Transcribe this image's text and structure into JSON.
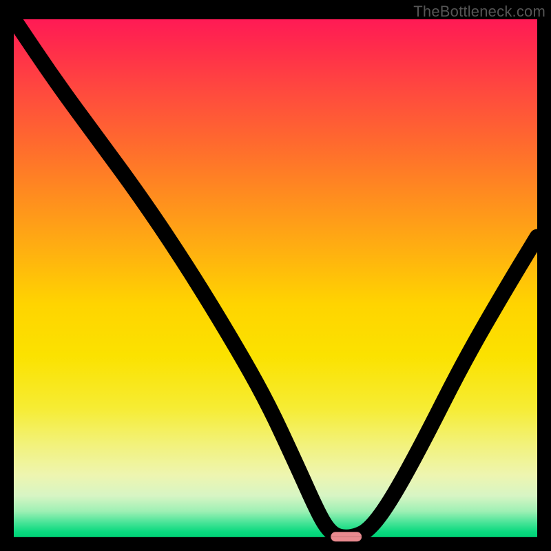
{
  "attribution": "TheBottleneck.com",
  "chart_data": {
    "type": "line",
    "title": "",
    "xlabel": "",
    "ylabel": "",
    "xlim": [
      0,
      100
    ],
    "ylim": [
      0,
      100
    ],
    "series": [
      {
        "name": "bottleneck-curve",
        "x": [
          0,
          8,
          16,
          24,
          32,
          40,
          48,
          54,
          58,
          60,
          62,
          65,
          68,
          72,
          78,
          86,
          94,
          100
        ],
        "values": [
          100,
          88,
          77,
          66,
          54,
          41,
          27,
          14,
          5,
          1.5,
          0,
          0,
          1.5,
          7,
          18,
          34,
          48,
          58
        ]
      }
    ],
    "optimal_zone": {
      "x_center": 63.5,
      "width_pct": 6
    },
    "background_gradient": {
      "top": "#ff1a55",
      "mid": "#ffd400",
      "bottom": "#00d276"
    }
  },
  "marker": {
    "semantic": "optimal-balance-marker",
    "color": "#e98a8f"
  }
}
